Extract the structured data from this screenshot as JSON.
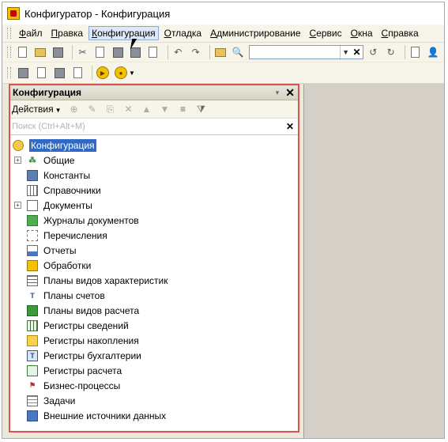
{
  "window": {
    "title": "Конфигуратор - Конфигурация"
  },
  "menu": [
    {
      "label": "Файл",
      "ul": "Ф",
      "rest": "айл"
    },
    {
      "label": "Правка",
      "ul": "П",
      "rest": "равка"
    },
    {
      "label": "Конфигурация",
      "ul": "К",
      "rest": "онфигурация"
    },
    {
      "label": "Отладка",
      "ul": "О",
      "rest": "тладка"
    },
    {
      "label": "Администрирование",
      "ul": "А",
      "rest": "дминистрирование"
    },
    {
      "label": "Сервис",
      "ul": "С",
      "rest": "ервис"
    },
    {
      "label": "Окна",
      "ul": "О",
      "rest": "кна"
    },
    {
      "label": "Справка",
      "ul": "С",
      "rest": "правка"
    }
  ],
  "active_menu": "Конфигурация",
  "panel": {
    "title": "Конфигурация",
    "actions_label": "Действия",
    "search_placeholder": "Поиск (Ctrl+Alt+M)",
    "root": "Конфигурация",
    "items": [
      {
        "label": "Общие",
        "icon": "common-icon",
        "expandable": true
      },
      {
        "label": "Константы",
        "icon": "constants-icon",
        "expandable": false
      },
      {
        "label": "Справочники",
        "icon": "catalogs-icon",
        "expandable": false
      },
      {
        "label": "Документы",
        "icon": "documents-icon",
        "expandable": true
      },
      {
        "label": "Журналы документов",
        "icon": "document-journals-icon",
        "expandable": false
      },
      {
        "label": "Перечисления",
        "icon": "enumerations-icon",
        "expandable": false
      },
      {
        "label": "Отчеты",
        "icon": "reports-icon",
        "expandable": false
      },
      {
        "label": "Обработки",
        "icon": "data-processors-icon",
        "expandable": false
      },
      {
        "label": "Планы видов характеристик",
        "icon": "characteristic-types-icon",
        "expandable": false
      },
      {
        "label": "Планы счетов",
        "icon": "chart-of-accounts-icon",
        "expandable": false
      },
      {
        "label": "Планы видов расчета",
        "icon": "calculation-types-icon",
        "expandable": false
      },
      {
        "label": "Регистры сведений",
        "icon": "information-registers-icon",
        "expandable": false
      },
      {
        "label": "Регистры накопления",
        "icon": "accumulation-registers-icon",
        "expandable": false
      },
      {
        "label": "Регистры бухгалтерии",
        "icon": "accounting-registers-icon",
        "expandable": false
      },
      {
        "label": "Регистры расчета",
        "icon": "calculation-registers-icon",
        "expandable": false
      },
      {
        "label": "Бизнес-процессы",
        "icon": "business-processes-icon",
        "expandable": false
      },
      {
        "label": "Задачи",
        "icon": "tasks-icon",
        "expandable": false
      },
      {
        "label": "Внешние источники данных",
        "icon": "external-data-sources-icon",
        "expandable": false
      }
    ]
  },
  "colors": {
    "highlight_border": "#d9534f",
    "selection": "#316ac5"
  }
}
